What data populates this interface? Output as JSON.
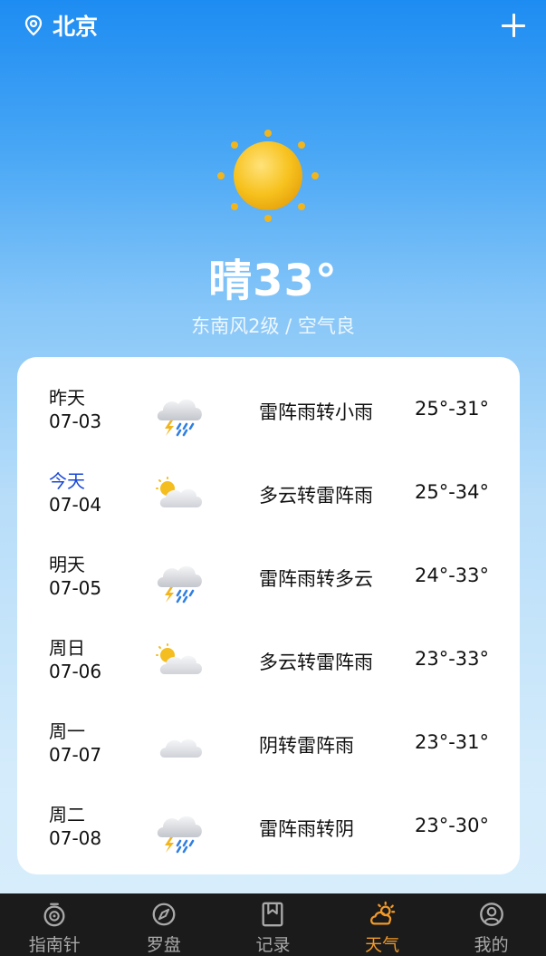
{
  "header": {
    "location": "北京",
    "location_icon": "location-pin-icon",
    "add_icon": "plus-icon"
  },
  "current": {
    "weather_icon": "sunny-icon",
    "headline": "晴33°",
    "detail": "东南风2级 / 空气良"
  },
  "forecast": [
    {
      "day": "昨天",
      "date": "07-03",
      "icon": "thunderstorm-icon",
      "condition": "雷阵雨转小雨",
      "range": "25°-31°"
    },
    {
      "day": "今天",
      "date": "07-04",
      "icon": "partly-cloudy-icon",
      "condition": "多云转雷阵雨",
      "range": "25°-34°"
    },
    {
      "day": "明天",
      "date": "07-05",
      "icon": "thunderstorm-icon",
      "condition": "雷阵雨转多云",
      "range": "24°-33°"
    },
    {
      "day": "周日",
      "date": "07-06",
      "icon": "partly-cloudy-icon",
      "condition": "多云转雷阵雨",
      "range": "23°-33°"
    },
    {
      "day": "周一",
      "date": "07-07",
      "icon": "cloudy-icon",
      "condition": "阴转雷阵雨",
      "range": "23°-31°"
    },
    {
      "day": "周二",
      "date": "07-08",
      "icon": "thunderstorm-icon",
      "condition": "雷阵雨转阴",
      "range": "23°-30°"
    }
  ],
  "tabs": [
    {
      "label": "指南针",
      "icon": "compass-icon",
      "active": false
    },
    {
      "label": "罗盘",
      "icon": "compass-needle-icon",
      "active": false
    },
    {
      "label": "记录",
      "icon": "bookmark-icon",
      "active": false
    },
    {
      "label": "天气",
      "icon": "weather-icon",
      "active": true
    },
    {
      "label": "我的",
      "icon": "profile-icon",
      "active": false
    }
  ],
  "colors": {
    "active_tab": "#f29a28",
    "today_label": "#1948d6",
    "tabbar_bg": "#1b1b1b"
  }
}
